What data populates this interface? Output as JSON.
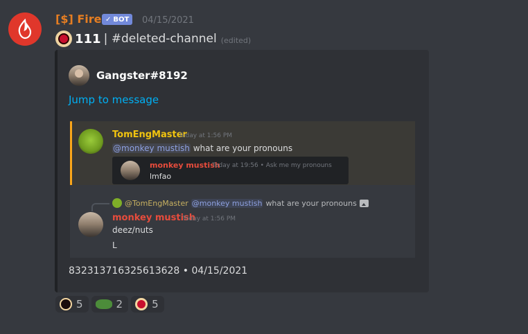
{
  "message": {
    "author": "[$] Fire",
    "bot_tag": "BOT",
    "timestamp": "04/15/2021",
    "count": "111",
    "text": "| #deleted-channel",
    "edited": "(edited)"
  },
  "embed": {
    "author_name": "Gangster#8192",
    "jump_link": "Jump to message",
    "quoted_first": {
      "author": "TomEngMaster",
      "time": "Today at 1:56 PM",
      "mention": "@monkey mustish",
      "text": "what are your pronouns",
      "inner": {
        "author": "monkey mustish",
        "time": "Today at 19:56 • Ask me my pronouns",
        "text": "lmfao"
      }
    },
    "quoted_second": {
      "reply_author": "@TomEngMaster",
      "reply_mention": "@monkey mustish",
      "reply_text": "what are your pronouns",
      "author": "monkey mustish",
      "time": "Today at 1:56 PM",
      "line1": "deez/nuts",
      "line2": "L"
    },
    "footer": "832313716325613628 • 04/15/2021"
  },
  "reactions": [
    {
      "emoji": "dark-circle-emoji",
      "count": "5"
    },
    {
      "emoji": "frog-emoji",
      "count": "2"
    },
    {
      "emoji": "red-circle-emoji",
      "count": "5"
    }
  ],
  "colors": {
    "background": "#36393f",
    "embed": "#2f3136",
    "author": "#e67e22",
    "link": "#00b0f4",
    "highlight_border": "#faa61a",
    "mention": "#8ea1e1",
    "red_name": "#e74c3c",
    "yellow_name": "#f1c40f"
  }
}
